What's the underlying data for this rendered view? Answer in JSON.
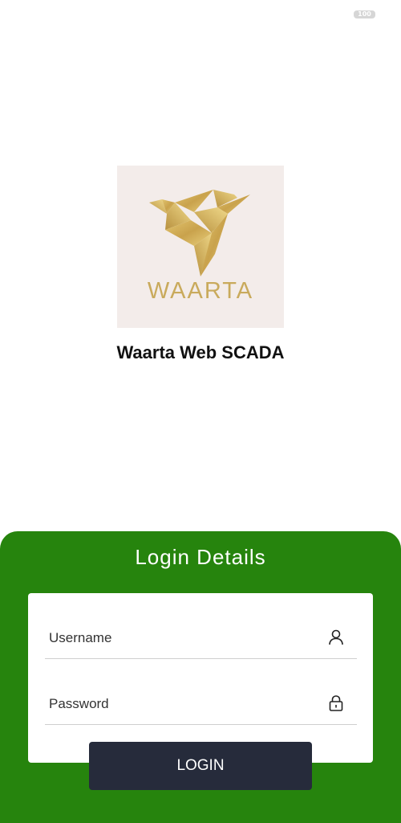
{
  "status_bar": {
    "battery_level": "100"
  },
  "logo": {
    "wordmark": "WAARTA",
    "gold_color": "#c9aa5c",
    "background_color": "#f3ecea"
  },
  "app": {
    "title": "Waarta Web SCADA"
  },
  "login": {
    "heading": "Login Details",
    "username_placeholder": "Username",
    "password_placeholder": "Password",
    "button_label": "LOGIN",
    "panel_color": "#26840d",
    "button_color": "#262b3b"
  },
  "icons": {
    "username": "user-icon",
    "password": "lock-icon"
  }
}
